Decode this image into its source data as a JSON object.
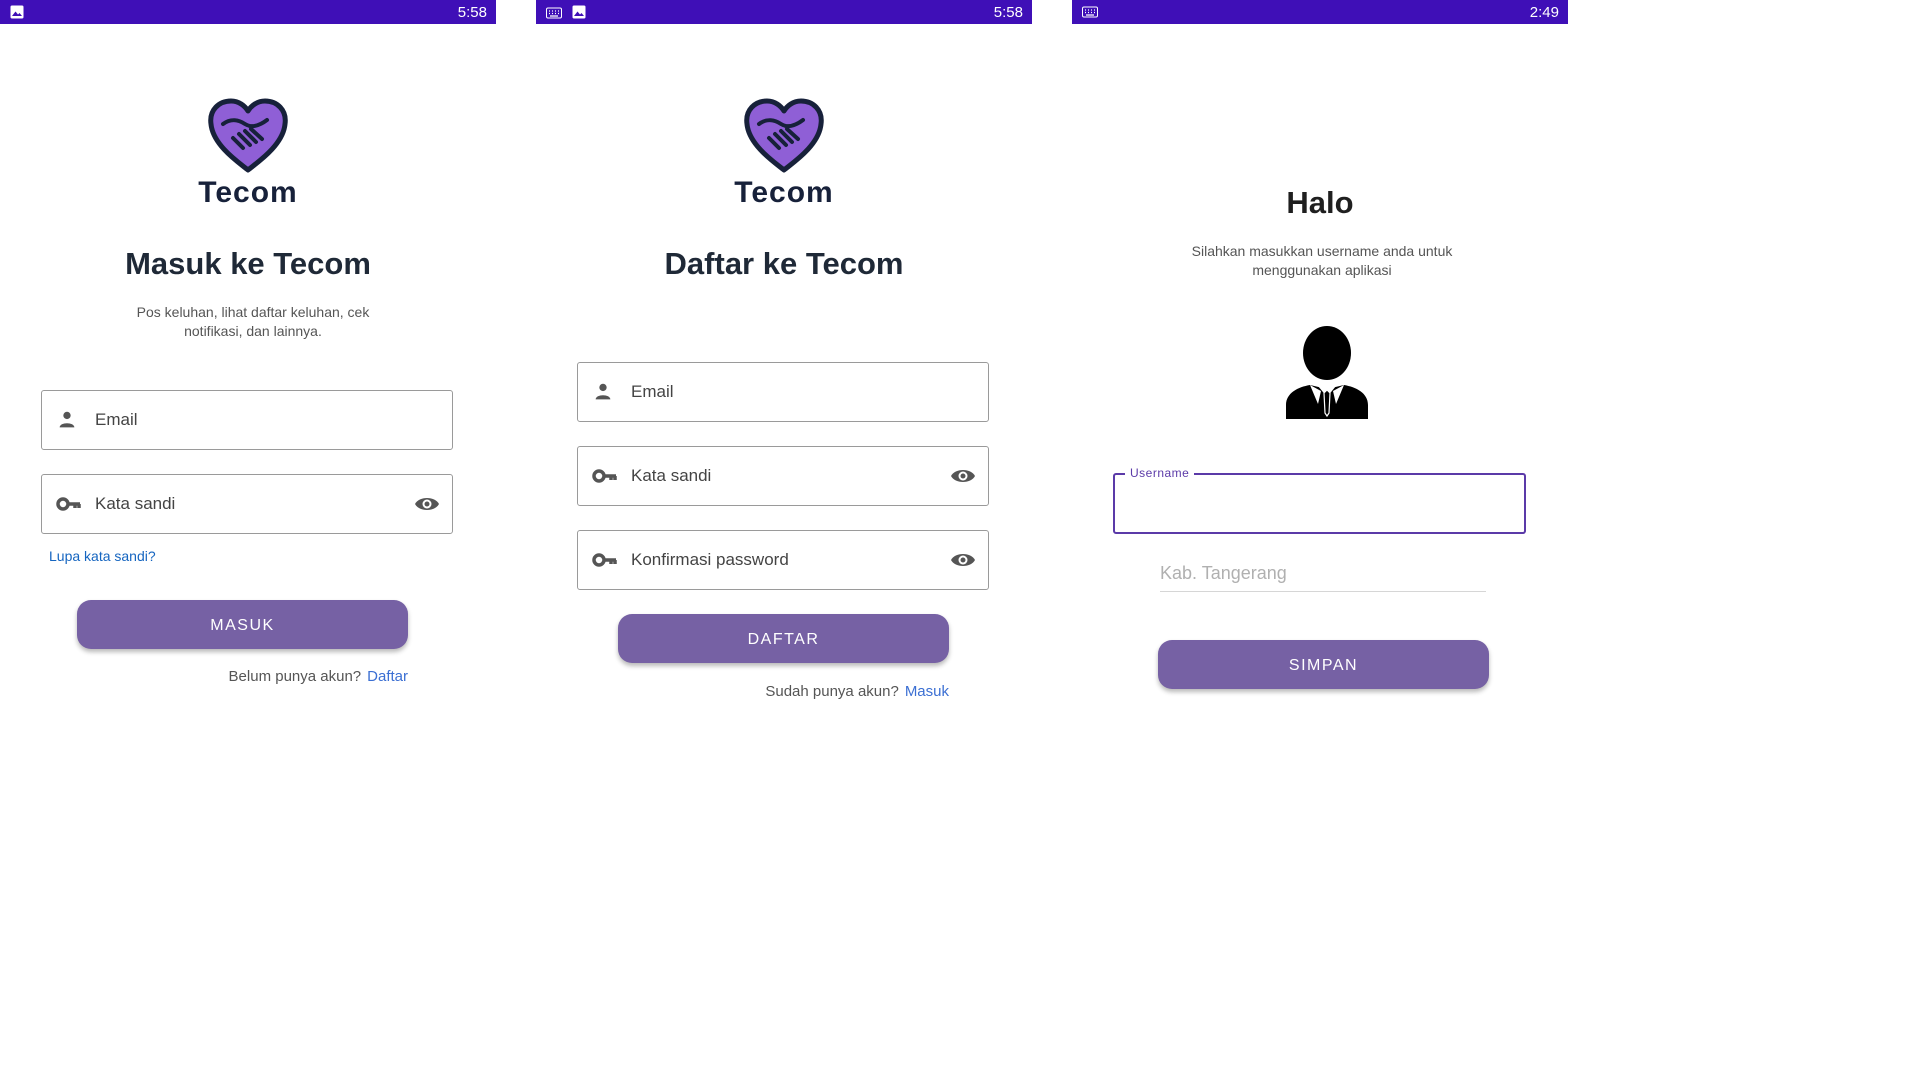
{
  "screens": [
    {
      "status_time": "5:58",
      "status_icons": [
        "image-icon"
      ],
      "brand": "Tecom",
      "title": "Masuk ke Tecom",
      "subtitle": "Pos keluhan, lihat daftar keluhan, cek notifikasi, dan lainnya.",
      "email_placeholder": "Email",
      "password_placeholder": "Kata sandi",
      "forgot_label": "Lupa kata sandi?",
      "button_label": "MASUK",
      "footer_text": "Belum punya akun?",
      "footer_link": "Daftar"
    },
    {
      "status_time": "5:58",
      "status_icons": [
        "keyboard-icon",
        "image-icon"
      ],
      "brand": "Tecom",
      "title": "Daftar ke Tecom",
      "email_placeholder": "Email",
      "password_placeholder": "Kata sandi",
      "confirm_placeholder": "Konfirmasi password",
      "button_label": "DAFTAR",
      "footer_text": "Sudah punya akun?",
      "footer_link": "Masuk"
    },
    {
      "status_time": "2:49",
      "status_icons": [
        "keyboard-icon"
      ],
      "title": "Halo",
      "subtitle": "Silahkan masukkan username anda untuk menggunakan aplikasi",
      "username_label": "Username",
      "region_placeholder": "Kab. Tangerang",
      "button_label": "SIMPAN"
    }
  ],
  "colors": {
    "status_bar": "#3f0fb7",
    "primary_button": "#7661a4",
    "logo_fill": "#8f5fd6",
    "link": "#1565c0",
    "focus": "#5b3aa8"
  }
}
